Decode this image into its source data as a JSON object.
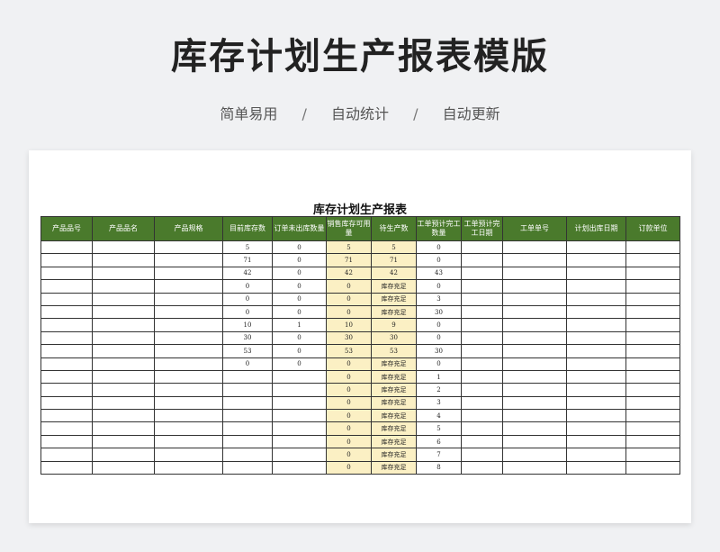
{
  "header": {
    "title": "库存计划生产报表模版",
    "tags": [
      "简单易用",
      "自动统计",
      "自动更新"
    ],
    "separator": "/"
  },
  "sheet": {
    "title": "库存计划生产报表",
    "columns": [
      "产品品号",
      "产品品名",
      "产品规格",
      "目前库存数",
      "订单未出库数量",
      "销售库存可用量",
      "待生产数",
      "工单预计完工数量",
      "工单预计完工日期",
      "工单单号",
      "计划出库日期",
      "订款单位"
    ],
    "highlight_color": "#fbf0c4",
    "header_color": "#4a7a2c",
    "rows": [
      [
        "",
        "",
        "",
        "5",
        "0",
        "5",
        "5",
        "0",
        "",
        "",
        "",
        ""
      ],
      [
        "",
        "",
        "",
        "71",
        "0",
        "71",
        "71",
        "0",
        "",
        "",
        "",
        ""
      ],
      [
        "",
        "",
        "",
        "42",
        "0",
        "42",
        "42",
        "43",
        "",
        "",
        "",
        ""
      ],
      [
        "",
        "",
        "",
        "0",
        "0",
        "0",
        "库存充足",
        "0",
        "",
        "",
        "",
        ""
      ],
      [
        "",
        "",
        "",
        "0",
        "0",
        "0",
        "库存充足",
        "3",
        "",
        "",
        "",
        ""
      ],
      [
        "",
        "",
        "",
        "0",
        "0",
        "0",
        "库存充足",
        "30",
        "",
        "",
        "",
        ""
      ],
      [
        "",
        "",
        "",
        "10",
        "1",
        "10",
        "9",
        "0",
        "",
        "",
        "",
        ""
      ],
      [
        "",
        "",
        "",
        "30",
        "0",
        "30",
        "30",
        "0",
        "",
        "",
        "",
        ""
      ],
      [
        "",
        "",
        "",
        "53",
        "0",
        "53",
        "53",
        "30",
        "",
        "",
        "",
        ""
      ],
      [
        "",
        "",
        "",
        "0",
        "0",
        "0",
        "库存充足",
        "0",
        "",
        "",
        "",
        ""
      ],
      [
        "",
        "",
        "",
        "",
        "",
        "0",
        "库存充足",
        "1",
        "",
        "",
        "",
        ""
      ],
      [
        "",
        "",
        "",
        "",
        "",
        "0",
        "库存充足",
        "2",
        "",
        "",
        "",
        ""
      ],
      [
        "",
        "",
        "",
        "",
        "",
        "0",
        "库存充足",
        "3",
        "",
        "",
        "",
        ""
      ],
      [
        "",
        "",
        "",
        "",
        "",
        "0",
        "库存充足",
        "4",
        "",
        "",
        "",
        ""
      ],
      [
        "",
        "",
        "",
        "",
        "",
        "0",
        "库存充足",
        "5",
        "",
        "",
        "",
        ""
      ],
      [
        "",
        "",
        "",
        "",
        "",
        "0",
        "库存充足",
        "6",
        "",
        "",
        "",
        ""
      ],
      [
        "",
        "",
        "",
        "",
        "",
        "0",
        "库存充足",
        "7",
        "",
        "",
        "",
        ""
      ],
      [
        "",
        "",
        "",
        "",
        "",
        "0",
        "库存充足",
        "8",
        "",
        "",
        "",
        ""
      ]
    ]
  }
}
